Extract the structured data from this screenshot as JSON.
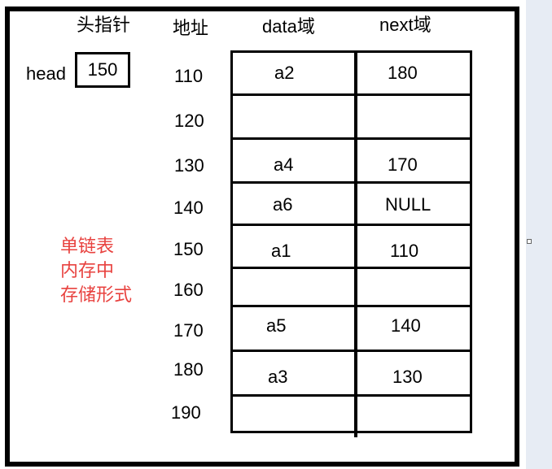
{
  "headers": {
    "head_pointer": "头指针",
    "address": "地址",
    "data_field": "data域",
    "next_field": "next域"
  },
  "head": {
    "label": "head",
    "value": "150"
  },
  "rows": [
    {
      "addr": "110",
      "data": "a2",
      "next": "180"
    },
    {
      "addr": "120",
      "data": "",
      "next": ""
    },
    {
      "addr": "130",
      "data": "a4",
      "next": "170"
    },
    {
      "addr": "140",
      "data": "a6",
      "next": "NULL"
    },
    {
      "addr": "150",
      "data": "a1",
      "next": "110"
    },
    {
      "addr": "160",
      "data": "",
      "next": ""
    },
    {
      "addr": "170",
      "data": "a5",
      "next": "140"
    },
    {
      "addr": "180",
      "data": "a3",
      "next": "130"
    },
    {
      "addr": "190",
      "data": "",
      "next": ""
    }
  ],
  "note": {
    "line1": "单链表",
    "line2": "内存中",
    "line3": "存储形式"
  },
  "colors": {
    "note": "#e8423f",
    "border": "#000000",
    "sidebar": "#e7ecf4"
  }
}
